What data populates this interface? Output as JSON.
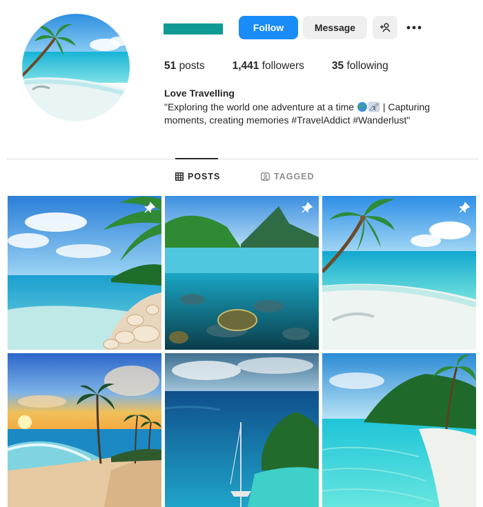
{
  "profile": {
    "follow_label": "Follow",
    "message_label": "Message",
    "posts_count": "51",
    "posts_label": "posts",
    "followers_count": "1,441",
    "followers_label": "followers",
    "following_count": "35",
    "following_label": "following",
    "full_name": "Love Travelling",
    "bio_part1": "\"Exploring the world one adventure at a time",
    "bio_part2": "| Capturing moments, creating memories #TravelAddict #Wanderlust\""
  },
  "tabs": [
    {
      "label": "POSTS",
      "icon": "grid-icon",
      "active": true
    },
    {
      "label": "TAGGED",
      "icon": "tag-icon",
      "active": false
    }
  ],
  "colors": {
    "follow_button": "#1a8cf7",
    "username_bar": "#0f9a93",
    "secondary_button": "#efefef"
  },
  "posts": [
    {
      "pinned": true
    },
    {
      "pinned": true
    },
    {
      "pinned": true
    },
    {
      "pinned": false
    },
    {
      "pinned": false
    },
    {
      "pinned": false
    }
  ]
}
